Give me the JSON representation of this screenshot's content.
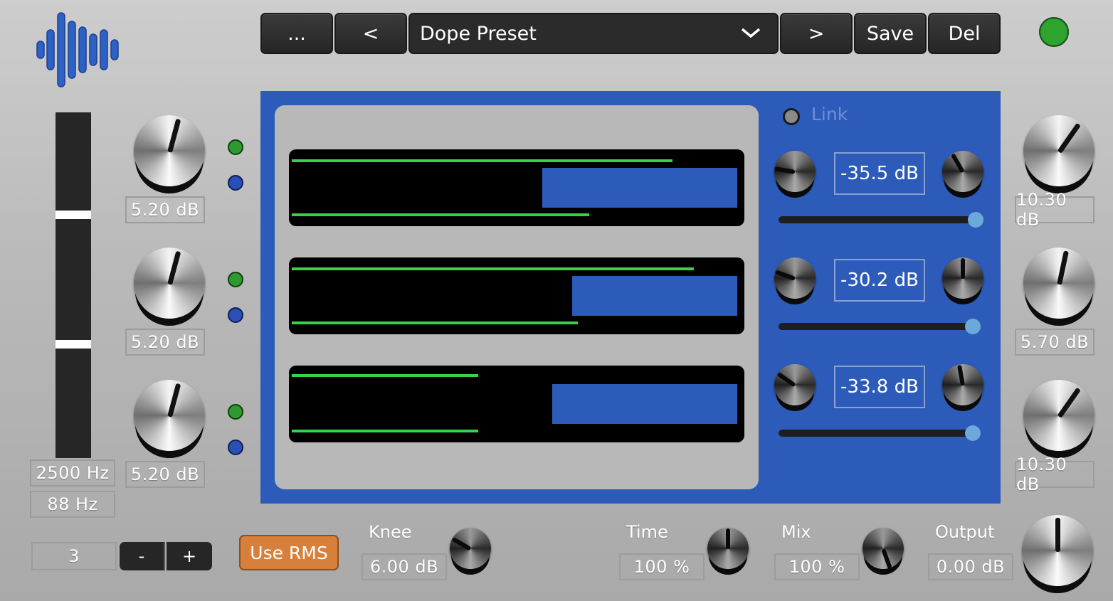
{
  "header": {
    "menu_label": "...",
    "prev_label": "<",
    "preset_name": "Dope Preset",
    "next_label": ">",
    "save_label": "Save",
    "delete_label": "Del",
    "status_led_color": "#2ea32e"
  },
  "left": {
    "crossover_high": "2500 Hz",
    "crossover_low": "88 Hz",
    "band_count": "3",
    "minus_label": "-",
    "plus_label": "+",
    "use_rms_label": "Use RMS",
    "gains": [
      "5.20 dB",
      "5.20 dB",
      "5.20 dB"
    ]
  },
  "panel": {
    "link_label": "Link",
    "thresholds": [
      "-35.5 dB",
      "-30.2 dB",
      "-33.8 dB"
    ]
  },
  "right": {
    "gains": [
      "10.30 dB",
      "5.70 dB",
      "10.30 dB"
    ]
  },
  "bottom": {
    "knee_label": "Knee",
    "knee_value": "6.00 dB",
    "time_label": "Time",
    "time_value": "100 %",
    "mix_label": "Mix",
    "mix_value": "100 %",
    "output_label": "Output",
    "output_value": "0.00 dB"
  },
  "colors": {
    "accent_blue": "#2d5bb9",
    "meter_green": "#37d24a",
    "led_green": "#2e9a2e",
    "led_blue": "#2a4fb8",
    "rms_button": "#d7803c"
  }
}
